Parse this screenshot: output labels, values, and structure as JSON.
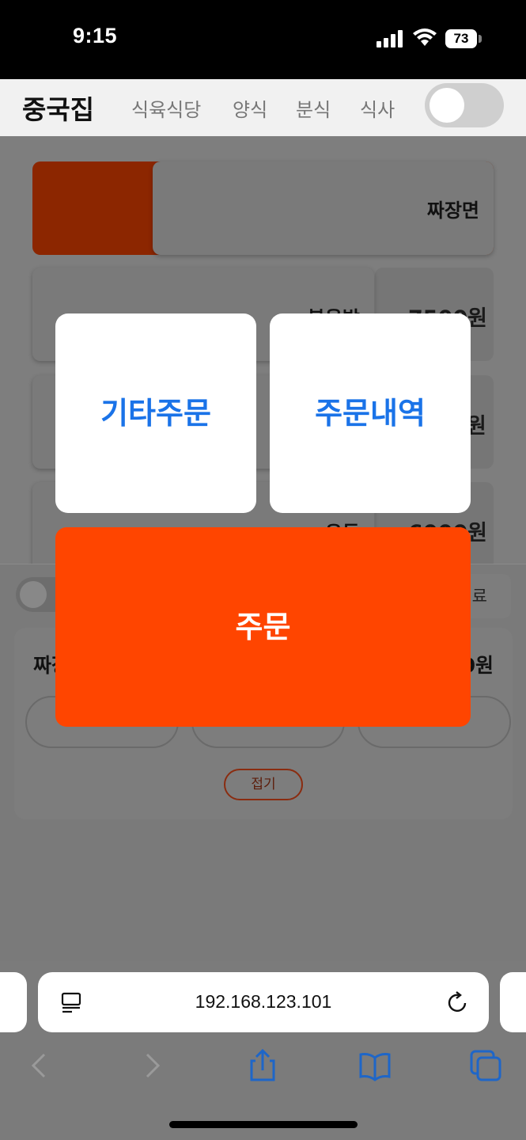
{
  "status_bar": {
    "time": "9:15",
    "battery": "73"
  },
  "nav": {
    "brand": "중국집",
    "items": [
      "식육식당",
      "양식",
      "분식",
      "식사"
    ]
  },
  "menu": {
    "items": [
      {
        "name": "짜장면",
        "price": ""
      },
      {
        "name": "볶음밥",
        "price": "7500원"
      },
      {
        "name": "",
        "price": "원"
      },
      {
        "name": "우동",
        "price": "6000원"
      }
    ]
  },
  "cart": {
    "close_label": "료",
    "title": "짜장",
    "total": "0원",
    "fold_label": "접기"
  },
  "modal": {
    "etc_order": "기타주문",
    "order_history": "주문내역",
    "order": "주문"
  },
  "browser": {
    "url": "192.168.123.101"
  },
  "colors": {
    "accent": "#ff4500",
    "link_blue": "#1a73e8"
  }
}
